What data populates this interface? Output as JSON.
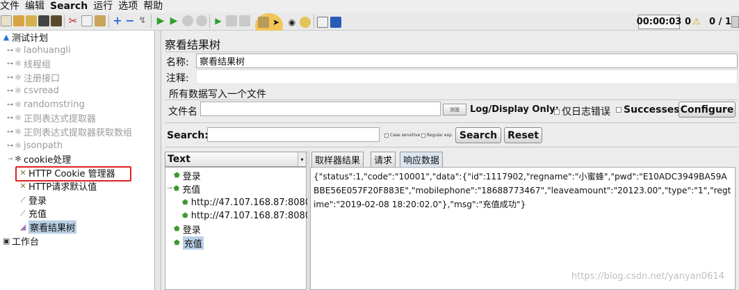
{
  "menu": [
    {
      "label": "文件",
      "bold": false
    },
    {
      "label": "编辑",
      "bold": false
    },
    {
      "label": "Search",
      "bold": true
    },
    {
      "label": "运行",
      "bold": false
    },
    {
      "label": "选项",
      "bold": false
    },
    {
      "label": "帮助",
      "bold": false
    }
  ],
  "status": {
    "timer": "00:00:03",
    "warnings": "0",
    "threads": "0 / 1"
  },
  "tree": {
    "root": "测试计划",
    "items": {
      "laohuangli": "laohuangli",
      "thread_group": "线程组",
      "register": "注册接口",
      "csvread": "csvread",
      "randomstring": "randomstring",
      "regex": "正则表达式提取器",
      "regex_get": "正则表达式提取器获取数组",
      "jsonpath": "jsonpath",
      "cookie": "cookie处理",
      "cookie_manager": "HTTP Cookie 管理器",
      "http_defaults": "HTTP请求默认值",
      "login": "登录",
      "recharge": "充值",
      "view_results": "察看结果树"
    },
    "workbench": "工作台"
  },
  "panel": {
    "title": "察看结果树",
    "name_label": "名称:",
    "name_value": "察看结果树",
    "comment_label": "注释:",
    "comment_value": "",
    "file_section": "所有数据写入一个文件",
    "file_label": "文件名",
    "file_value": "",
    "browse": "浏览",
    "log_display": "Log/Display Only:",
    "errors_only": "仅日志错误",
    "successes": "Successes",
    "configure": "Configure"
  },
  "search": {
    "label": "Search:",
    "value": "",
    "case_sensitive": "Case sensitive",
    "regular_exp": "Regular exp.",
    "search_btn": "Search",
    "reset_btn": "Reset"
  },
  "results": {
    "renderer": "Text",
    "nodes": {
      "login1": "登录",
      "recharge1": "充值",
      "url1": "http://47.107.168.87:8080/",
      "url2": "http://47.107.168.87:8080/",
      "login2": "登录",
      "recharge2": "充值"
    },
    "tabs": {
      "sampler": "取样器结果",
      "request": "请求",
      "response": "响应数据"
    },
    "response_text": "{\"status\":1,\"code\":\"10001\",\"data\":{\"id\":1117902,\"regname\":\"小蜜蜂\",\"pwd\":\"E10ADC3949BA59ABBE56E057F20F883E\",\"mobilephone\":\"18688773467\",\"leaveamount\":\"20123.00\",\"type\":\"1\",\"regtime\":\"2019-02-08 18:20:02.0\"},\"msg\":\"充值成功\"}"
  },
  "watermark": "https://blog.csdn.net/yanyan0614"
}
